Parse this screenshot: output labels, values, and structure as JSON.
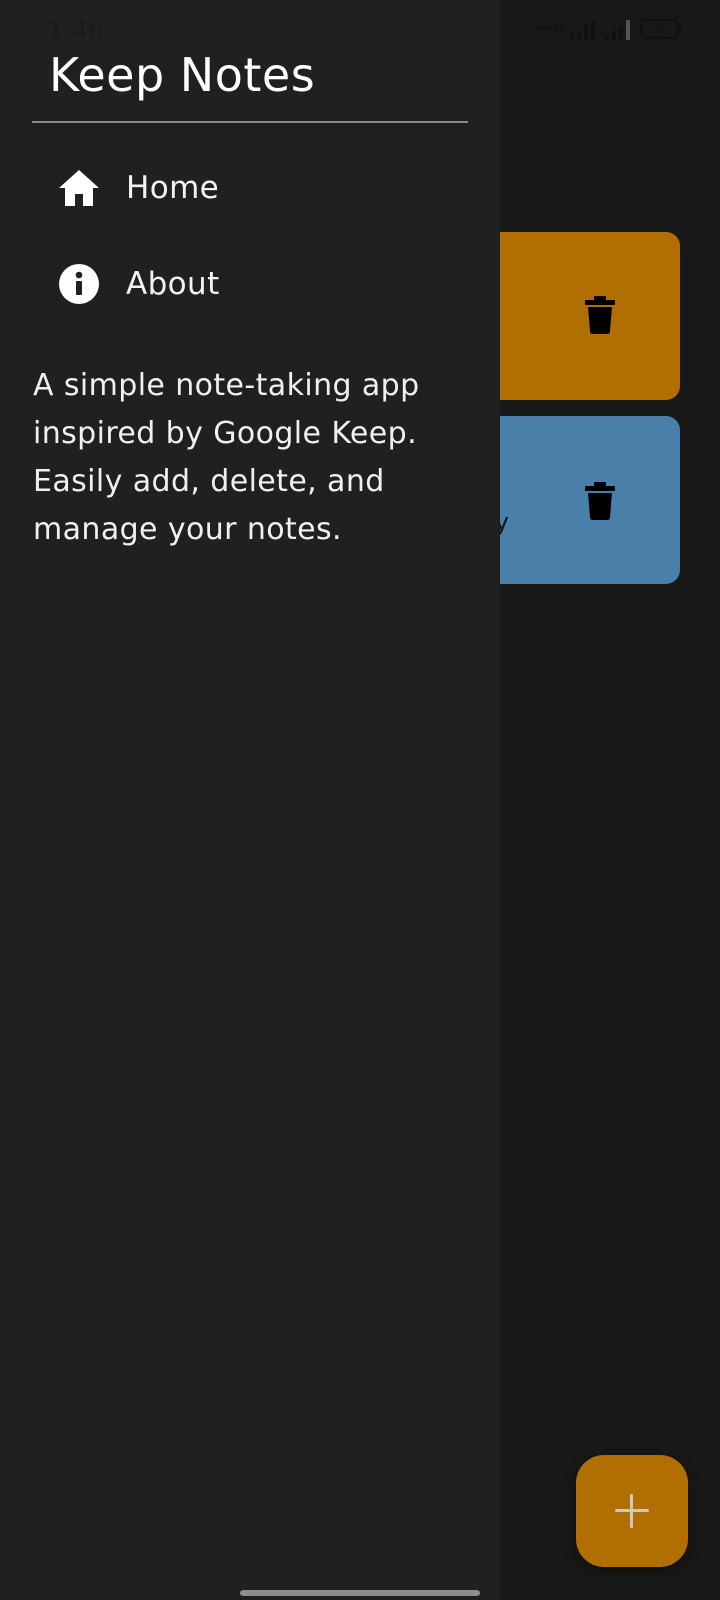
{
  "status_bar": {
    "time": "1:46",
    "network_badge": "VoLTE",
    "battery_level": "75"
  },
  "drawer": {
    "title": "Keep Notes",
    "menu": [
      {
        "label": "Home",
        "icon": "home-icon"
      },
      {
        "label": "About",
        "icon": "info-icon"
      }
    ],
    "about_text": "A simple note-taking app inspired by Google Keep. Easily add, delete, and manage your notes."
  },
  "notes": [
    {
      "color": "#b06f00",
      "snippet": "",
      "action_icon": "trash-icon"
    },
    {
      "color": "#4a7faa",
      "snippet": "ay",
      "action_icon": "trash-icon"
    }
  ],
  "fab": {
    "icon": "plus-icon",
    "color": "#b06f00"
  },
  "colors": {
    "drawer_background": "#202020",
    "screen_background": "#181818",
    "accent": "#b06f00",
    "note_blue": "#4a7faa"
  }
}
